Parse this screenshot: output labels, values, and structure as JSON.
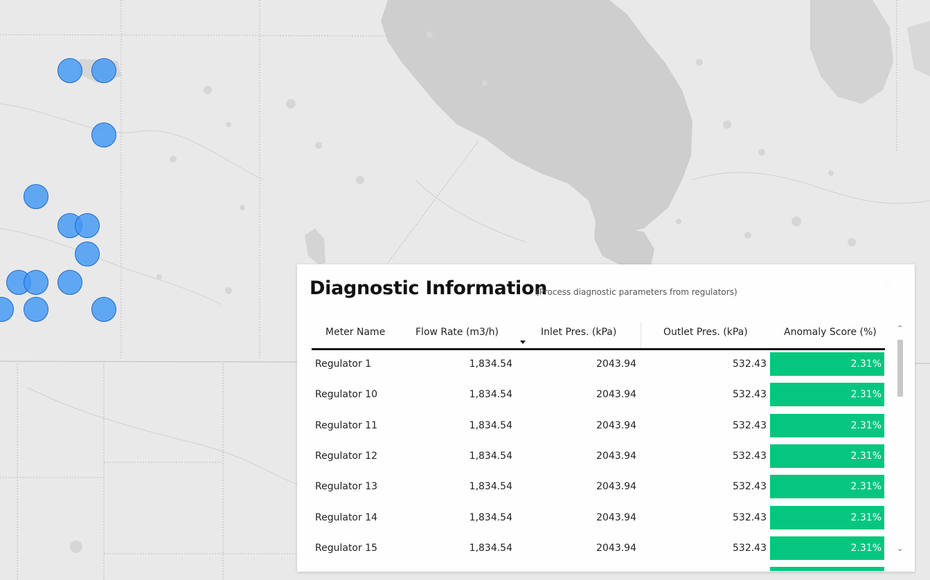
{
  "panel": {
    "title": "Diagnostic Information",
    "subtitle": "(Process diagnostic parameters from regulators)"
  },
  "table": {
    "headers": {
      "meter_name": "Meter Name",
      "flow_rate": "Flow Rate (m3/h)",
      "inlet": "Inlet Pres. (kPa)",
      "outlet": "Outlet Pres. (kPa)",
      "anomaly": "Anomaly Score (%)"
    },
    "sorted_column": "flow_rate",
    "sort_direction": "descending",
    "rows": [
      {
        "name": "Regulator 1",
        "flow": "1,834.54",
        "inlet": "2043.94",
        "outlet": "532.43",
        "score": "2.31%"
      },
      {
        "name": "Regulator 10",
        "flow": "1,834.54",
        "inlet": "2043.94",
        "outlet": "532.43",
        "score": "2.31%"
      },
      {
        "name": "Regulator 11",
        "flow": "1,834.54",
        "inlet": "2043.94",
        "outlet": "532.43",
        "score": "2.31%"
      },
      {
        "name": "Regulator 12",
        "flow": "1,834.54",
        "inlet": "2043.94",
        "outlet": "532.43",
        "score": "2.31%"
      },
      {
        "name": "Regulator 13",
        "flow": "1,834.54",
        "inlet": "2043.94",
        "outlet": "532.43",
        "score": "2.31%"
      },
      {
        "name": "Regulator 14",
        "flow": "1,834.54",
        "inlet": "2043.94",
        "outlet": "532.43",
        "score": "2.31%"
      },
      {
        "name": "Regulator 15",
        "flow": "1,834.54",
        "inlet": "2043.94",
        "outlet": "532.43",
        "score": "2.31%"
      }
    ]
  },
  "colors": {
    "anomaly_fill": "#06c67f",
    "marker_fill": "#4299f5",
    "marker_stroke": "#1f66cc",
    "water": "#cfcfcf",
    "land": "#e9e9e9"
  },
  "icons": {
    "sort": "caret-down-icon",
    "scroll_up": "chevron-up-icon",
    "scroll_down": "chevron-down-icon",
    "markers": "circle-icon"
  },
  "map": {
    "marker_count": 15
  }
}
